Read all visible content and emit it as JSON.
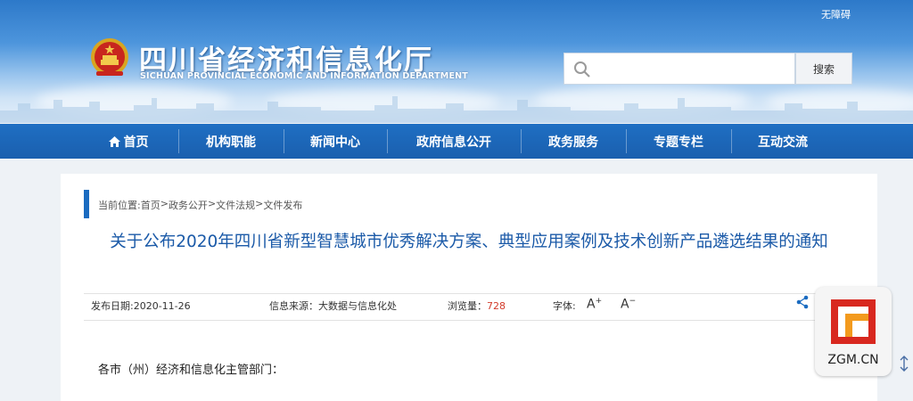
{
  "header": {
    "accessibility_link": "无障碍",
    "site_title": "四川省经济和信息化厅",
    "site_subtitle": "SICHUAN PROVINCIAL ECONOMIC AND INFORMATION DEPARTMENT",
    "search": {
      "placeholder": "",
      "button_label": "搜索"
    }
  },
  "nav": {
    "items": [
      {
        "label": "首页",
        "icon": "home-icon"
      },
      {
        "label": "机构职能"
      },
      {
        "label": "新闻中心"
      },
      {
        "label": "政府信息公开"
      },
      {
        "label": "政务服务"
      },
      {
        "label": "专题专栏"
      },
      {
        "label": "互动交流"
      }
    ]
  },
  "breadcrumb": {
    "prefix": "当前位置:",
    "items": [
      "首页",
      "政务公开",
      "文件法规",
      "文件发布"
    ],
    "separator": ">"
  },
  "article": {
    "title": "关于公布2020年四川省新型智慧城市优秀解决方案、典型应用案例及技术创新产品遴选结果的通知",
    "publish_date_label": "发布日期:2020-11-26",
    "source_label": "信息来源：大数据与信息化处",
    "views_label": "浏览量：",
    "views_count": "728",
    "font_label": "字体:",
    "font_increase": "A",
    "font_decrease": "A",
    "salutation": "各市（州）经济和信息化主管部门："
  },
  "watermark": {
    "text": "ZGM.CN"
  },
  "colors": {
    "nav_bg": "#1a5fae",
    "title_blue": "#1b5aa8",
    "views_red": "#d23a2a",
    "wechat_green": "#2aae3a"
  }
}
